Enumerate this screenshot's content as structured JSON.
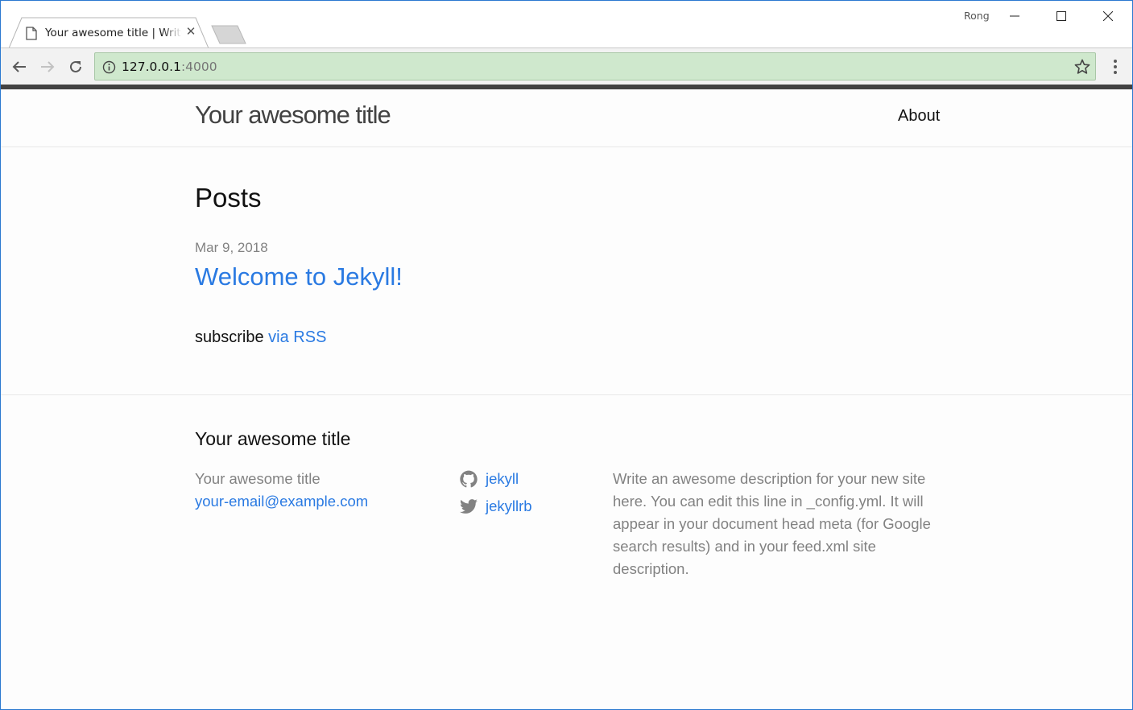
{
  "browser": {
    "tab_title": "Your awesome title | Write an awesome description for your new site here.",
    "tab_close": "✕",
    "profile_name": "Rong",
    "url_host": "127.0.0.1",
    "url_port": ":4000"
  },
  "header": {
    "site_title": "Your awesome title",
    "nav_about": "About"
  },
  "main": {
    "heading": "Posts",
    "posts": [
      {
        "date": "Mar 9, 2018",
        "title": "Welcome to Jekyll!"
      }
    ],
    "rss_prefix": "subscribe ",
    "rss_link": "via RSS"
  },
  "footer": {
    "heading": "Your awesome title",
    "name": "Your awesome title",
    "email": "your-email@example.com",
    "github": "jekyll",
    "twitter": "jekyllrb",
    "description": "Write an awesome description for your new site here. You can edit this line in _config.yml. It will appear in your document head meta (for Google search results) and in your feed.xml site description."
  },
  "colors": {
    "link": "#2a7ae2",
    "text": "#111111",
    "muted": "#828282",
    "omnibox_secure": "#cfe8cd",
    "top_border": "#424242"
  },
  "icons": [
    "page-icon",
    "close-icon",
    "minimize-icon",
    "maximize-icon",
    "window-close-icon",
    "back-icon",
    "forward-icon",
    "reload-icon",
    "info-icon",
    "star-icon",
    "menu-icon",
    "github-icon",
    "twitter-icon"
  ]
}
